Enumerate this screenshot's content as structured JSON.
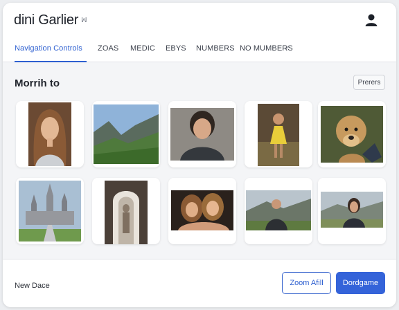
{
  "header": {
    "app_title": "dini Garlier",
    "title_mark": "ꟽ"
  },
  "tabs": [
    {
      "label": "Navigation Controls",
      "active": true
    },
    {
      "label": "ZOAS",
      "active": false
    },
    {
      "label": "MEDIC",
      "active": false
    },
    {
      "label": "EBYS",
      "active": false
    },
    {
      "label": "NUMBERS",
      "active": false
    },
    {
      "label": "NO MUMBERS",
      "active": false
    }
  ],
  "tab_check": "✓",
  "main": {
    "section_title": "Morrih to",
    "preview_button": "Prerers"
  },
  "gallery": {
    "items": [
      {
        "icon": "portrait-woman-photo"
      },
      {
        "icon": "mountain-valley-photo"
      },
      {
        "icon": "portrait-man-photo"
      },
      {
        "icon": "child-yellow-dress-photo"
      },
      {
        "icon": "dog-photo"
      },
      {
        "icon": "cathedral-photo"
      },
      {
        "icon": "archway-statue-photo"
      },
      {
        "icon": "two-women-photo"
      },
      {
        "icon": "man-landscape-photo"
      },
      {
        "icon": "woman-landscape-photo"
      }
    ]
  },
  "footer": {
    "label": "New Dace",
    "secondary_button": "Zoom Afill",
    "primary_button": "Dordgame"
  },
  "colors": {
    "accent": "#2d5fd0",
    "primary_button": "#3463d9"
  }
}
